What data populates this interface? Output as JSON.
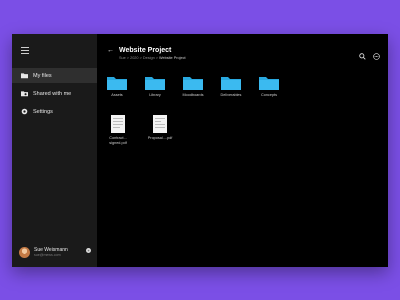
{
  "sidebar": {
    "menu_icon": "hamburger-icon",
    "items": [
      {
        "label": "My files",
        "icon": "folder-icon",
        "active": true
      },
      {
        "label": "Shared with me",
        "icon": "shared-icon",
        "active": false
      },
      {
        "label": "Settings",
        "icon": "gear-icon",
        "active": false
      }
    ],
    "user": {
      "name": "Sue Weismann",
      "email": "sue@mews.com",
      "add": "+"
    }
  },
  "main": {
    "back_glyph": "←",
    "title": "Website Project",
    "breadcrumb": {
      "part1": "Sue > 2020 > Design > ",
      "current": "Website Project"
    },
    "top_icons": [
      "search-icon",
      "more-icon"
    ],
    "folders": [
      "Assets",
      "Library",
      "Moodboards",
      "Deliverables",
      "Concepts"
    ],
    "files": [
      {
        "line1": "Contract...",
        "line2": "signed.pdf"
      },
      {
        "line1": "Proposal....pdf",
        "line2": ""
      }
    ]
  },
  "colors": {
    "background": "#7b4fe6",
    "folder": "#29a9e0",
    "sidebar": "#1a1a1a",
    "window": "#000000"
  }
}
